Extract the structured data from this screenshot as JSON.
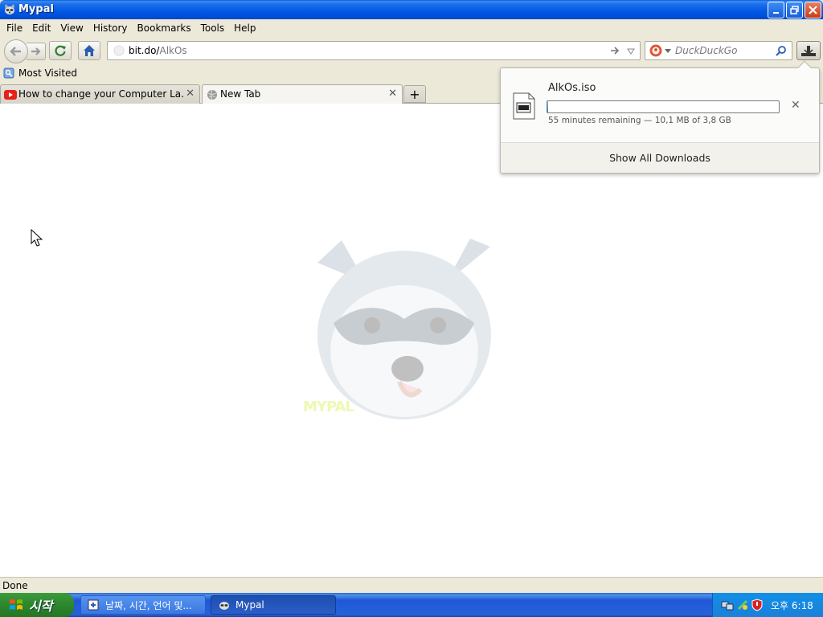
{
  "window": {
    "title": "Mypal"
  },
  "menu": {
    "items": [
      "File",
      "Edit",
      "View",
      "History",
      "Bookmarks",
      "Tools",
      "Help"
    ]
  },
  "navbar": {
    "url_host": "bit.do/",
    "url_path": "AlkOs",
    "search_placeholder": "DuckDuckGo",
    "icons": {
      "back": "arrow-left-icon",
      "forward": "arrow-right-icon",
      "reload": "reload-icon",
      "home": "home-icon",
      "go": "go-arrow-icon",
      "search": "magnifier-icon",
      "downloads": "download-icon"
    }
  },
  "bookmarks": {
    "most_visited": "Most Visited"
  },
  "tabs": [
    {
      "label": "How to change your Computer La…",
      "active": false,
      "icon": "youtube-icon"
    },
    {
      "label": "New Tab",
      "active": true,
      "icon": "globe-icon"
    }
  ],
  "downloads_panel": {
    "filename": "AlkOs.iso",
    "progress_fraction": 0.003,
    "status": "55 minutes remaining — 10,1 MB of 3,8 GB",
    "show_all": "Show All Downloads"
  },
  "content": {
    "mascot_label": "MYPAL"
  },
  "statusbar": {
    "text": "Done"
  },
  "taskbar": {
    "start_label": "시작",
    "tasks": [
      {
        "label": "날짜, 시간, 언어 및...",
        "active": false
      },
      {
        "label": "Mypal",
        "active": true
      }
    ],
    "clock": "오후 6:18"
  },
  "colors": {
    "titlebar": "#0058e6",
    "taskbar": "#2662d8",
    "start": "#2f8a2f",
    "chrome": "#ece9d8"
  }
}
